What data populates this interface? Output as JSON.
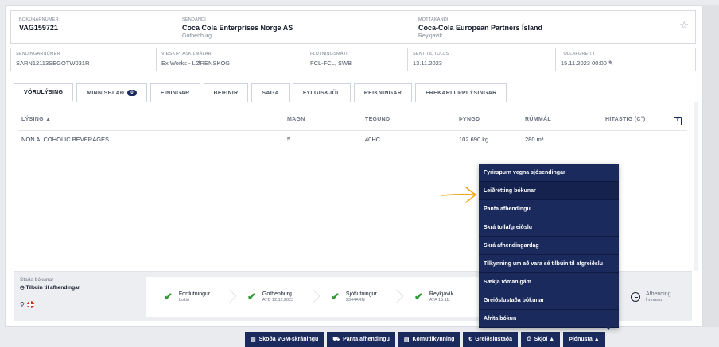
{
  "header": {
    "booking_label": "BÓKUNARNÚMER",
    "booking_no": "VAG159721",
    "sender_label": "SENDANDI",
    "sender_name": "Coca Cola Enterprises Norge AS",
    "sender_city": "Gothenburg",
    "receiver_label": "MÓTTAKANDI",
    "receiver_name": "Coca-Cola European Partners Ísland",
    "receiver_city": "Reykjavík",
    "star_icon": "star-outline-icon"
  },
  "details": {
    "shipment_label": "SENDINGARNÚMER",
    "shipment_no": "SARN12113SEGOTW031R",
    "terms_label": "VIÐSKIPTASKILMÁLAR",
    "terms_value": "Ex Works - LØRENSKOG",
    "transport_label": "FLUTNINGSMÁTI",
    "transport_value": "FCL-FCL, SWB",
    "customs_sent_label": "SENT TIL TOLLS",
    "customs_sent_value": "13.11.2023",
    "cleared_label": "TOLLAFGREITT",
    "cleared_value": "15.11.2023 00:00"
  },
  "tabs": [
    {
      "label": "VÖRULÝSING"
    },
    {
      "label": "MINNISBLAÐ",
      "badge": "0"
    },
    {
      "label": "EININGAR"
    },
    {
      "label": "BEIÐNIR"
    },
    {
      "label": "SAGA"
    },
    {
      "label": "FYLGISKJÖL"
    },
    {
      "label": "REIKNINGAR"
    },
    {
      "label": "FREKARI UPPLÝSINGAR"
    }
  ],
  "table": {
    "columns": [
      "LÝSING ▲",
      "MAGN",
      "TEGUND",
      "ÞYNGD",
      "RÚMMÁL",
      "HITASTIG (C°)"
    ],
    "rows": [
      [
        "NON ALCOHOLIC BEVERAGES",
        "5",
        "40HC",
        "102.690 kg",
        "280 m³",
        ""
      ]
    ],
    "export_icon": "excel-export-icon"
  },
  "status": {
    "title": "Staða bókunar",
    "current": "Tilbúin til afhendingar",
    "steps": [
      {
        "name": "Forflutningur",
        "sub": "Lokið"
      },
      {
        "name": "Gothenburg",
        "sub": "ATD 12.11.2023"
      },
      {
        "name": "Sjóflutningur",
        "sub": "2344ARN"
      },
      {
        "name": "Reykjavík",
        "sub": "ATA 15.11."
      }
    ],
    "last_step": {
      "name": "Afhending",
      "sub": "Í vinnslu"
    }
  },
  "service_menu": [
    "Fyrirspurn vegna sjósendingar",
    "Leiðrétting bókunar",
    "Panta afhendingu",
    "Skrá tollafgreiðslu",
    "Skrá afhendingardag",
    "Tilkynning um að vara sé tilbúin til afgreiðslu",
    "Sækja tóman gám",
    "Greiðslustaða bókunar",
    "Afrita bókun"
  ],
  "bottom_buttons": [
    {
      "label": "Skoða VGM-skráningu",
      "icon": "document-icon"
    },
    {
      "label": "Panta afhendingu",
      "icon": "truck-icon"
    },
    {
      "label": "Komutilkynning",
      "icon": "document-icon"
    },
    {
      "label": "Greiðslustaða",
      "icon": "euro-icon"
    },
    {
      "label": "Skjöl ▲",
      "icon": "printer-icon"
    },
    {
      "label": "Þjónusta ▲",
      "icon": ""
    }
  ],
  "colors": {
    "brand": "#1b2a5c",
    "success": "#2e9a33",
    "annotation": "#f2a71b"
  }
}
